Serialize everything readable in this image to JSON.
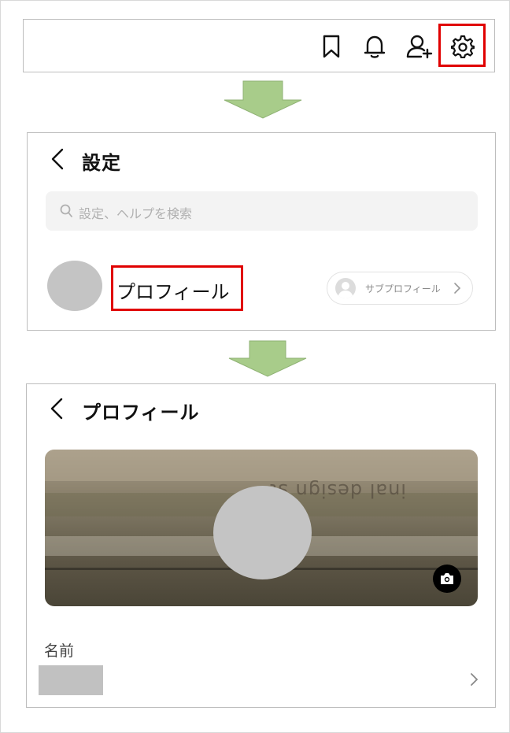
{
  "panel1": {
    "icons": [
      "bookmark-icon",
      "bell-icon",
      "add-friend-icon",
      "gear-icon"
    ]
  },
  "panel2": {
    "title": "設定",
    "search_placeholder": "設定、ヘルプを検索",
    "profile_label": "プロフィール",
    "sub_profile_label": "サブプロフィール"
  },
  "panel3": {
    "title": "プロフィール",
    "cover_text": "inal design st",
    "name_label": "名前"
  },
  "colors": {
    "highlight": "#e00000",
    "arrow": "#a8cc8a"
  }
}
